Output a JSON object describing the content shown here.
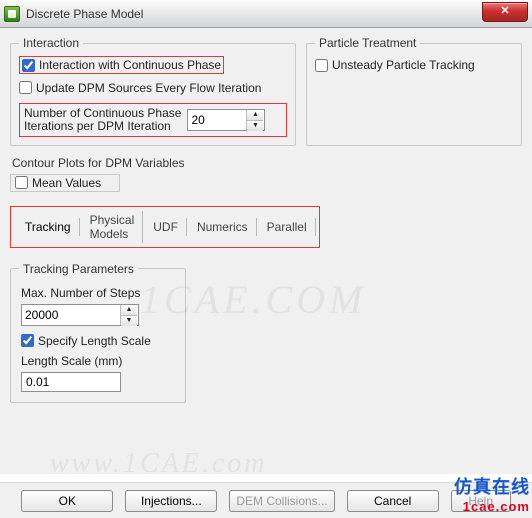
{
  "window": {
    "title": "Discrete Phase Model",
    "close_glyph": "✕"
  },
  "interaction": {
    "legend": "Interaction",
    "continuous_phase_label": "Interaction with Continuous Phase",
    "continuous_phase_checked": true,
    "update_sources_label": "Update DPM Sources Every Flow Iteration",
    "update_sources_checked": false,
    "iter_label_line1": "Number of Continuous Phase",
    "iter_label_line2": "Iterations per DPM Iteration",
    "iter_value": "20"
  },
  "particle_treatment": {
    "legend": "Particle Treatment",
    "unsteady_label": "Unsteady Particle Tracking",
    "unsteady_checked": false
  },
  "contour": {
    "legend": "Contour Plots for DPM Variables",
    "mean_values_label": "Mean Values",
    "mean_values_checked": false
  },
  "tabs": {
    "items": [
      "Tracking",
      "Physical Models",
      "UDF",
      "Numerics",
      "Parallel"
    ],
    "active_index": 0
  },
  "tracking_params": {
    "legend": "Tracking Parameters",
    "max_steps_label": "Max. Number of Steps",
    "max_steps_value": "20000",
    "specify_length_scale_label": "Specify Length Scale",
    "specify_length_scale_checked": true,
    "length_scale_label": "Length Scale (mm)",
    "length_scale_value": "0.01"
  },
  "buttons": {
    "ok": "OK",
    "injections": "Injections...",
    "dem": "DEM Collisions...",
    "cancel": "Cancel",
    "help": "Help"
  },
  "watermarks": {
    "wm1": "1CAE.COM",
    "wm2": "www.1CAE.com",
    "brand_cn": "仿真在线",
    "brand_en": "1cae.com"
  },
  "icons": {
    "spin_up": "▲",
    "spin_down": "▼"
  }
}
